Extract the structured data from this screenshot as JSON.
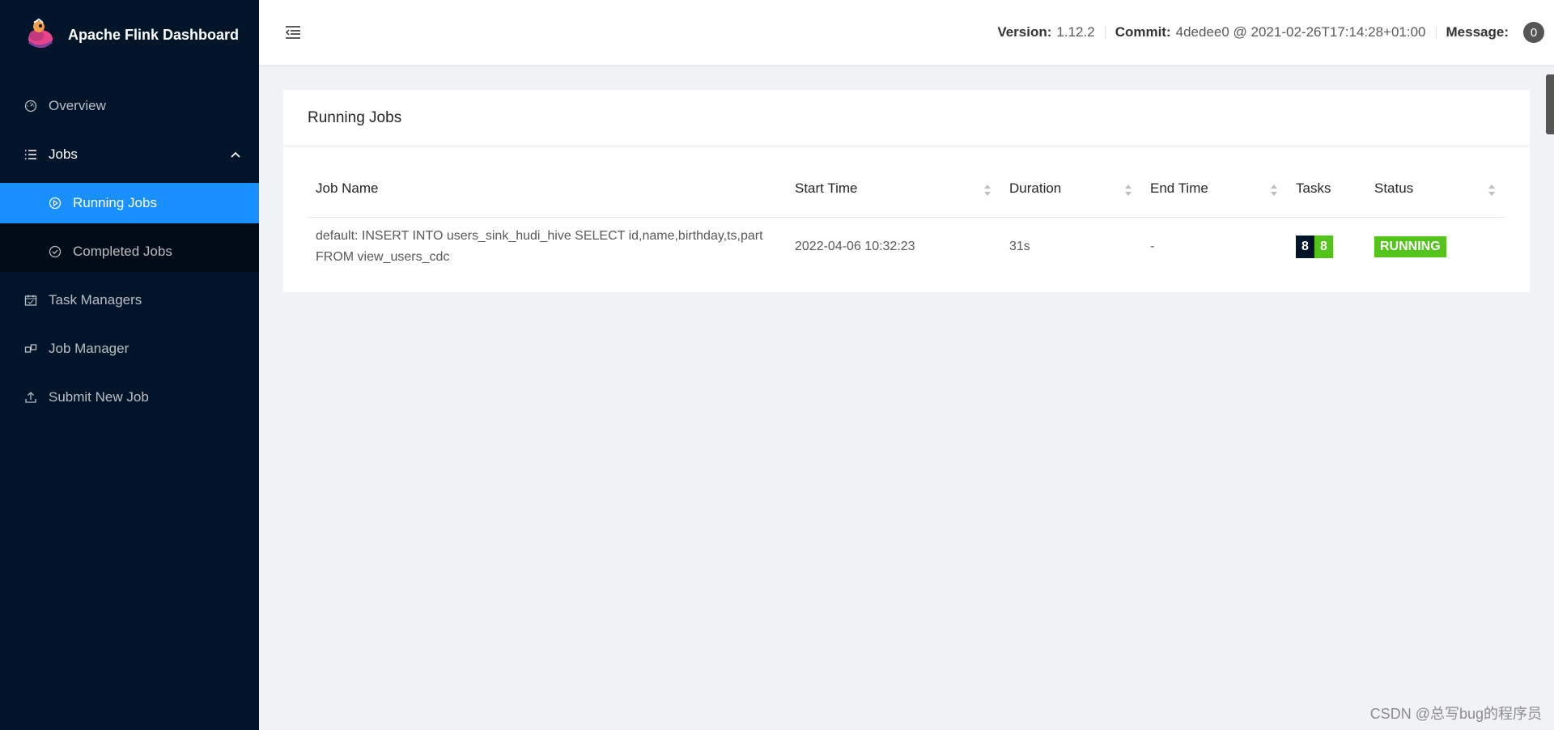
{
  "app": {
    "title": "Apache Flink Dashboard"
  },
  "sidebar": {
    "items": [
      {
        "label": "Overview",
        "icon": "dashboard-icon"
      },
      {
        "label": "Jobs",
        "icon": "list-icon",
        "expanded": true
      },
      {
        "label": "Task Managers",
        "icon": "schedule-icon"
      },
      {
        "label": "Job Manager",
        "icon": "build-icon"
      },
      {
        "label": "Submit New Job",
        "icon": "upload-icon"
      }
    ],
    "jobs_sub": [
      {
        "label": "Running Jobs",
        "icon": "play-circle-icon",
        "active": true
      },
      {
        "label": "Completed Jobs",
        "icon": "check-circle-icon"
      }
    ]
  },
  "header": {
    "version_label": "Version:",
    "version_value": "1.12.2",
    "commit_label": "Commit:",
    "commit_value": "4dedee0 @ 2021-02-26T17:14:28+01:00",
    "message_label": "Message:",
    "message_count": "0"
  },
  "card": {
    "title": "Running Jobs",
    "columns": [
      "Job Name",
      "Start Time",
      "Duration",
      "End Time",
      "Tasks",
      "Status"
    ],
    "rows": [
      {
        "job_name_line1": "default: INSERT INTO users_sink_hudi_hive SELECT id,name,birthday,ts,part",
        "job_name_line2": "FROM view_users_cdc",
        "start_time": "2022-04-06 10:32:23",
        "duration": "31s",
        "end_time": "-",
        "tasks_total": "8",
        "tasks_running": "8",
        "status": "RUNNING"
      }
    ]
  },
  "colors": {
    "sidebar_bg": "#001529",
    "accent": "#1890ff",
    "running_green": "#52c41a",
    "task_total_bg": "#001529"
  },
  "watermark": "CSDN @总写bug的程序员"
}
